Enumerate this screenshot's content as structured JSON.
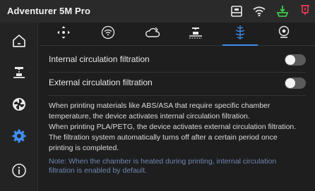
{
  "header": {
    "title": "Adventurer 5M Pro",
    "status_icons": [
      "printer-icon",
      "wifi-icon",
      "filament-icon",
      "nozzle-icon"
    ]
  },
  "sidebar": {
    "items": [
      {
        "name": "home-icon",
        "active": false
      },
      {
        "name": "print-bed-icon",
        "active": false
      },
      {
        "name": "fan-filter-icon",
        "active": false
      },
      {
        "name": "settings-icon",
        "active": true
      },
      {
        "name": "info-icon",
        "active": false
      }
    ]
  },
  "tabs": [
    {
      "name": "move-icon",
      "active": false
    },
    {
      "name": "network-icon",
      "active": false
    },
    {
      "name": "cloud-icon",
      "active": false
    },
    {
      "name": "camera-bed-icon",
      "active": false
    },
    {
      "name": "filtration-icon",
      "active": true
    },
    {
      "name": "webcam-icon",
      "active": false
    }
  ],
  "settings": {
    "internal_label": "Internal circulation filtration",
    "internal_on": false,
    "external_label": "External circulation filtration",
    "external_on": false
  },
  "description": {
    "line1": "When printing materials like ABS/ASA that require specific chamber",
    "line2": "temperature, the device activates internal circulation filtration.",
    "line3": "When printing PLA/PETG, the device activates external circulation filtration.",
    "line4": "The filtration system automatically turns off after a certain period once",
    "line5": "printing is completed."
  },
  "note": {
    "line1": "Note: When the chamber is heated during printing, internal circulation",
    "line2": "filtration is enabled by default."
  },
  "colors": {
    "accent": "#3f8ef0",
    "status_green": "#3fc94a",
    "status_red": "#e23a55",
    "note": "#6d87b0"
  }
}
